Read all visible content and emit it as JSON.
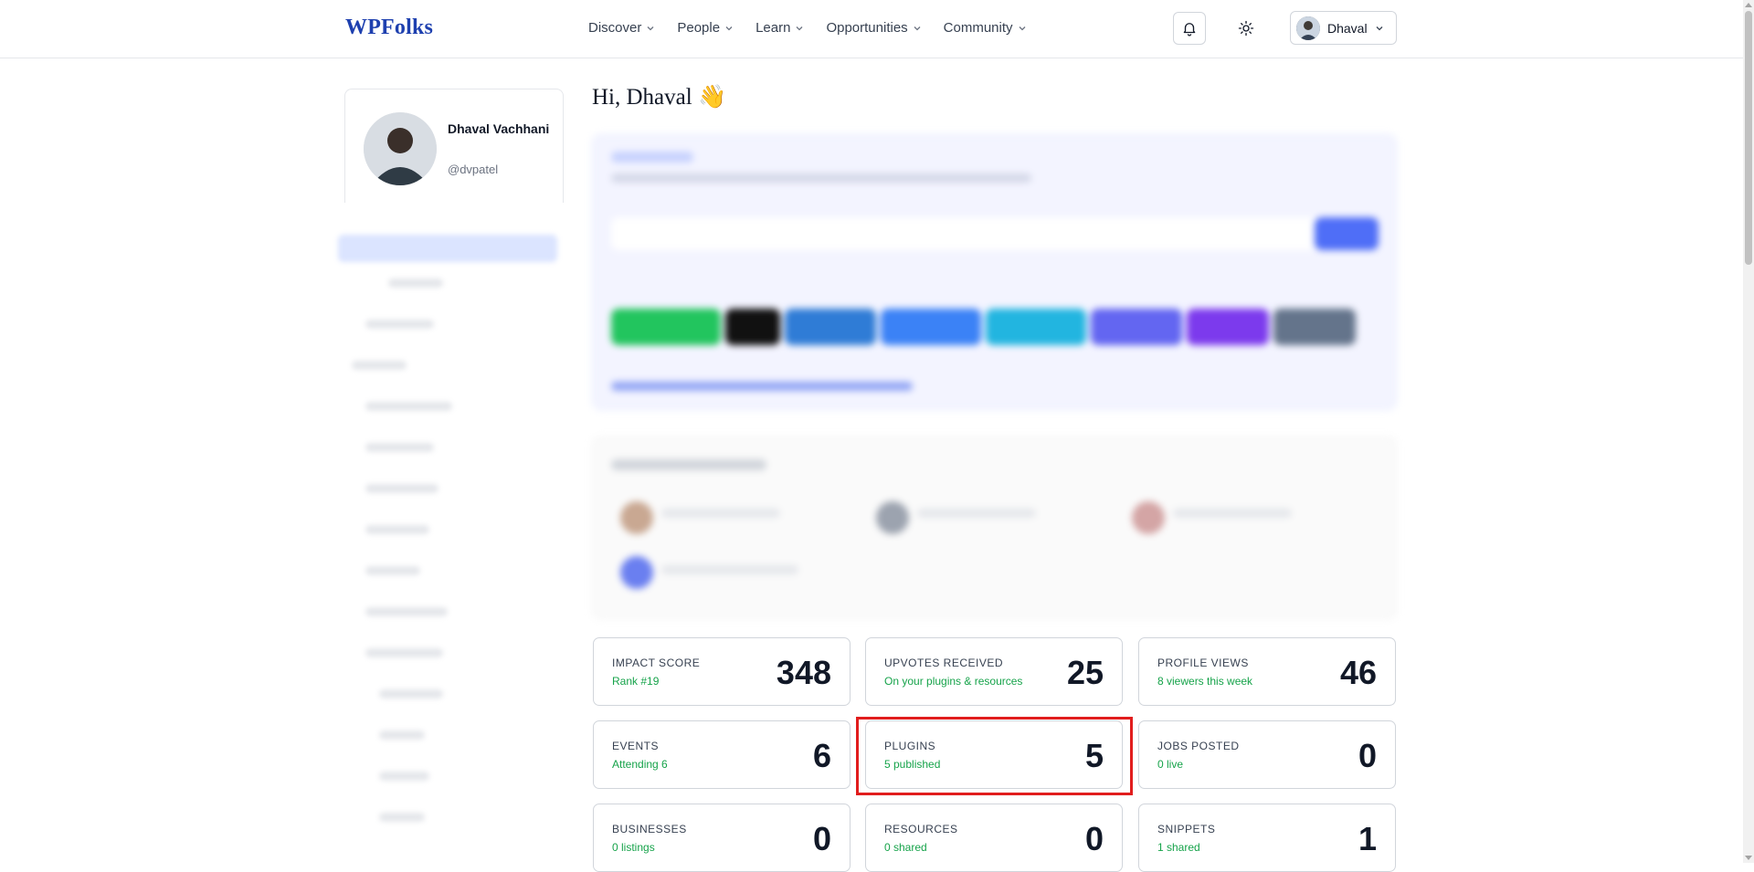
{
  "header": {
    "logo": "WPFolks",
    "nav": [
      "Discover",
      "People",
      "Learn",
      "Opportunities",
      "Community"
    ],
    "user_name": "Dhaval"
  },
  "profile": {
    "name": "Dhaval Vachhani",
    "handle": "@dvpatel"
  },
  "greeting": "Hi, Dhaval 👋",
  "stats": [
    {
      "label": "IMPACT SCORE",
      "sub": "Rank #19",
      "value": "348"
    },
    {
      "label": "UPVOTES RECEIVED",
      "sub": "On your plugins & resources",
      "value": "25"
    },
    {
      "label": "PROFILE VIEWS",
      "sub": "8 viewers this week",
      "value": "46"
    },
    {
      "label": "EVENTS",
      "sub": "Attending 6",
      "value": "6"
    },
    {
      "label": "PLUGINS",
      "sub": "5 published",
      "value": "5"
    },
    {
      "label": "JOBS POSTED",
      "sub": "0 live",
      "value": "0"
    },
    {
      "label": "BUSINESSES",
      "sub": "0 listings",
      "value": "0"
    },
    {
      "label": "RESOURCES",
      "sub": "0 shared",
      "value": "0"
    },
    {
      "label": "SNIPPETS",
      "sub": "1 shared",
      "value": "1"
    }
  ],
  "colors": {
    "brand": "#1e40af",
    "accent_green": "#16a34a",
    "highlight": "#e11d1d"
  }
}
